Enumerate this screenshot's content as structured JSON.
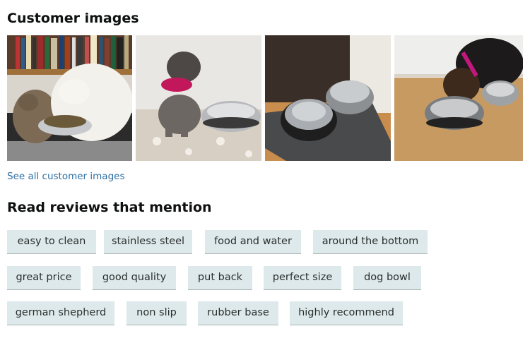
{
  "customer_images": {
    "heading": "Customer images",
    "images": [
      {
        "subject": "two cats eating from a stainless bowl on a mat"
      },
      {
        "subject": "small grey dog with pink bandana beside a steel bowl"
      },
      {
        "subject": "two stainless steel bowls on a grey mat"
      },
      {
        "subject": "dog eating from a steel bowl on a wooden floor"
      }
    ],
    "see_all_label": "See all customer images"
  },
  "mentions": {
    "heading": "Read reviews that mention",
    "chips": [
      "easy to clean",
      "stainless steel",
      "food and water",
      "around the bottom",
      "great price",
      "good quality",
      "put back",
      "perfect size",
      "dog bowl",
      "german shepherd",
      "non slip",
      "rubber base",
      "highly recommend"
    ]
  },
  "colors": {
    "chip_background": "#dde9ea",
    "chip_border": "#a9b3b4",
    "link": "#2d6fa5",
    "heading": "#0f1111"
  }
}
